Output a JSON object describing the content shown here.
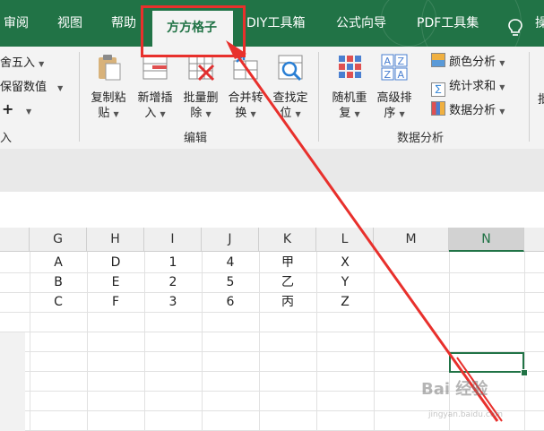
{
  "tabs": [
    {
      "label": "审阅"
    },
    {
      "label": "视图"
    },
    {
      "label": "帮助"
    },
    {
      "label": "方方格子",
      "active": true
    },
    {
      "label": "DIY工具箱"
    },
    {
      "label": "公式向导"
    },
    {
      "label": "PDF工具集"
    }
  ],
  "tab_right_fragment": "操",
  "ribbon": {
    "left_fragments": [
      "舍五入",
      "保留数值",
      "+",
      "入"
    ],
    "edit_group": {
      "label": "编辑",
      "buttons": [
        {
          "line1": "复制粘",
          "line2": "贴"
        },
        {
          "line1": "新增插",
          "line2": "入"
        },
        {
          "line1": "批量删",
          "line2": "除"
        },
        {
          "line1": "合并转",
          "line2": "换"
        },
        {
          "line1": "查找定",
          "line2": "位"
        }
      ]
    },
    "analysis_group": {
      "label": "数据分析",
      "buttons": [
        {
          "line1": "随机重",
          "line2": "复"
        },
        {
          "line1": "高级排",
          "line2": "序"
        }
      ],
      "small_items": [
        {
          "label": "颜色分析"
        },
        {
          "label": "统计求和"
        },
        {
          "label": "数据分析"
        }
      ]
    },
    "right_fragment": "批"
  },
  "columns": [
    "G",
    "H",
    "I",
    "J",
    "K",
    "L",
    "M",
    "N"
  ],
  "rows": [
    [
      "A",
      "D",
      "1",
      "4",
      "甲",
      "X",
      "",
      ""
    ],
    [
      "B",
      "E",
      "2",
      "5",
      "乙",
      "Y",
      "",
      ""
    ],
    [
      "C",
      "F",
      "3",
      "6",
      "丙",
      "Z",
      "",
      ""
    ]
  ],
  "watermark": "Bai 经验",
  "watermark_sub": "jingyan.baidu.com",
  "colors": {
    "tabbar": "#217346",
    "ribbon_bg": "#f3f3f3",
    "annotation_red": "#e8302c",
    "selection_green": "#217346"
  }
}
